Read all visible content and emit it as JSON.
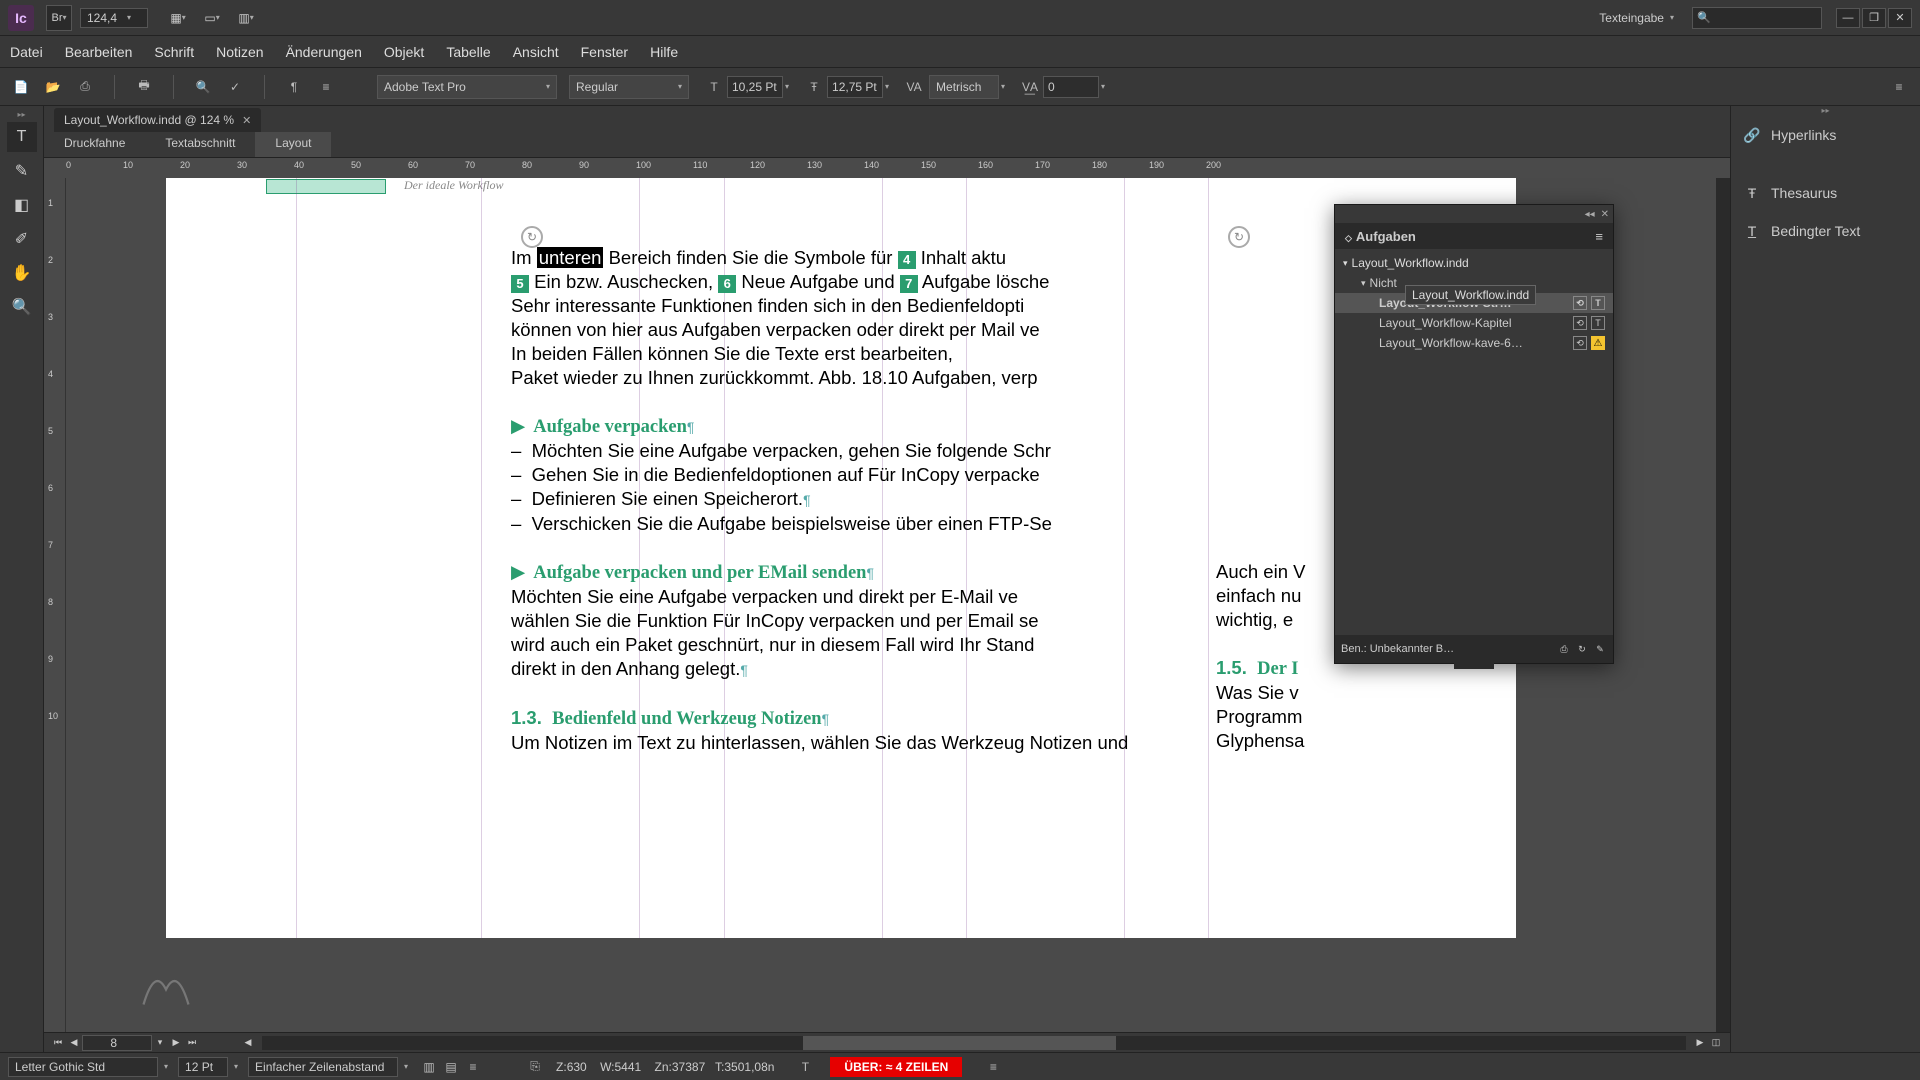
{
  "titlebar": {
    "app": "Ic",
    "bridge": "Br",
    "zoom": "124,4",
    "workspace": "Texteingabe"
  },
  "menu": [
    "Datei",
    "Bearbeiten",
    "Schrift",
    "Notizen",
    "Änderungen",
    "Objekt",
    "Tabelle",
    "Ansicht",
    "Fenster",
    "Hilfe"
  ],
  "toolbar": {
    "font": "Adobe Text Pro",
    "style": "Regular",
    "size": "10,25 Pt",
    "leading": "12,75 Pt",
    "kerning": "Metrisch",
    "tracking": "0"
  },
  "doc_tab": {
    "label": "Layout_Workflow.indd @ 124 %"
  },
  "view_tabs": [
    "Druckfahne",
    "Textabschnitt",
    "Layout"
  ],
  "ruler_h": [
    "0",
    "10",
    "20",
    "30",
    "40",
    "50",
    "60",
    "70",
    "80",
    "90",
    "100",
    "110",
    "120",
    "130",
    "140",
    "150",
    "160",
    "170",
    "180",
    "190",
    "200"
  ],
  "ruler_v": [
    "1",
    "2",
    "3",
    "4",
    "5",
    "6",
    "7",
    "8",
    "9",
    "10"
  ],
  "header_running": "Der ideale Workflow",
  "body": {
    "p1_a": "Im ",
    "p1_hl": "unteren",
    "p1_b": " Bereich finden Sie die Symbole für ",
    "p1_c": " Inhalt aktu",
    "p2_a": " Ein bzw. Auschecken, ",
    "p2_b": " Neue Aufgabe und ",
    "p2_c": " Aufgabe lösche",
    "p3": "Sehr interessante Funktionen finden sich in den Bedienfeldopti",
    "p4": "können von hier aus Aufgaben verpacken oder direkt per Mail ve",
    "p5": "In beiden Fällen können Sie die Texte erst bearbeiten, ",
    "p6": "Paket wieder zu Ihnen zurückkommt. Abb. 18.10 Aufgaben, verp",
    "h1": "Aufgabe verpacken",
    "li1": "Möchten Sie eine Aufgabe verpacken, gehen Sie folgende Schr",
    "li2": "Gehen Sie in die Bedienfeldoptionen auf Für InCopy verpacke",
    "li3": "Definieren Sie einen Speicherort.",
    "li4": "Verschicken Sie die Aufgabe beispielsweise über einen FTP-Se",
    "h2": "Aufgabe verpacken und per EMail senden",
    "p7": "Möchten Sie eine Aufgabe verpacken und direkt per E-Mail ve",
    "p8": "wählen Sie die Funktion Für InCopy verpacken und per Email se",
    "p9": "wird auch ein Paket geschnürt, nur in diesem Fall wird Ihr Stand",
    "p10": "direkt in den Anhang gelegt.",
    "h3_num": "1.3.",
    "h3": "Bedienfeld und Werkzeug Notizen",
    "p11": "Um Notizen im Text zu hinterlassen, wählen Sie das Werkzeug Notizen und",
    "badges": {
      "b4": "4",
      "b5": "5",
      "b6": "6",
      "b7": "7"
    }
  },
  "page2": {
    "t1": "Auch ein V",
    "t2": "einfach nu",
    "t3": "wichtig, e",
    "h_num": "1.5.",
    "h": "Der I",
    "t4": "Was Sie v",
    "t5": "Programm",
    "t6": "Glyphensa"
  },
  "panel": {
    "title": "Aufgaben",
    "root": "Layout_Workflow.indd",
    "group": "Nicht",
    "tooltip": "Layout_Workflow.indd",
    "items": [
      {
        "label": "Layout_Workflow-Str…",
        "active": true,
        "warn": false
      },
      {
        "label": "Layout_Workflow-Kapitel",
        "active": false,
        "warn": false
      },
      {
        "label": "Layout_Workflow-kave-6…",
        "active": false,
        "warn": true
      }
    ],
    "user": "Ben.: Unbekannter B…"
  },
  "right_panel": [
    "Hyperlinks",
    "Thesaurus",
    "Bedingter Text"
  ],
  "status": {
    "font": "Letter Gothic Std",
    "size": "12 Pt",
    "spacing": "Einfacher Zeilenabstand",
    "info": "Z:630    W:5441    Zn:37387   T:3501,08n",
    "over": "ÜBER:  ≈ 4 ZEILEN"
  },
  "nav_page": "       8"
}
